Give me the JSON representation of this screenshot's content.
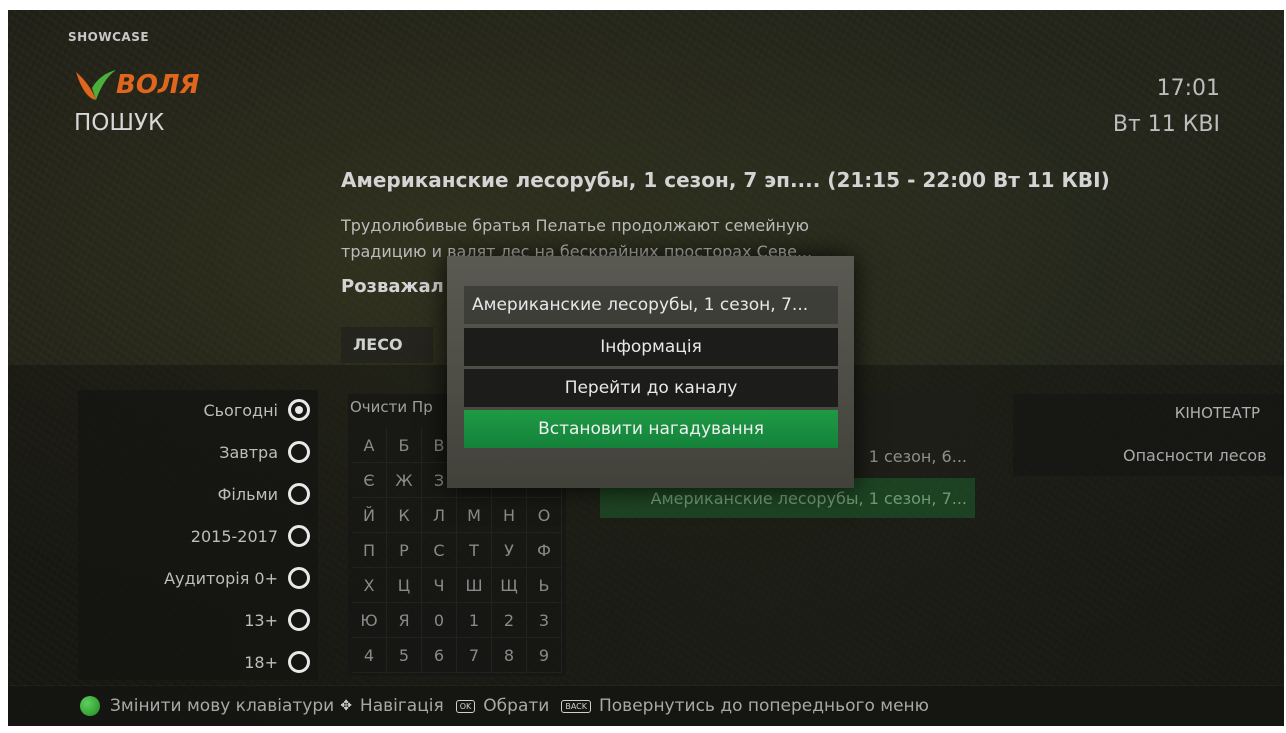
{
  "header": {
    "channel_label": "SHOWCASE",
    "brand": "ВОЛЯ",
    "page_title": "ПОШУК",
    "time": "17:01",
    "date": "Вт 11 КВІ"
  },
  "program": {
    "title": "Американские лесорубы, 1 сезон, 7 эп.... (21:15 - 22:00 Вт 11 КВІ)",
    "description_line1": "Трудолюбивые братья Пелатье продолжают семейную",
    "description_line2": "традицию и валят лес на бескрайних просторах Севе...",
    "genre": "Розважал"
  },
  "search": {
    "query": "ЛЕСО"
  },
  "filters": [
    {
      "label": "Сьогодні",
      "selected": true
    },
    {
      "label": "Завтра",
      "selected": false
    },
    {
      "label": "Фільми",
      "selected": false
    },
    {
      "label": "2015-2017",
      "selected": false
    },
    {
      "label": "Аудиторія 0+",
      "selected": false
    },
    {
      "label": "13+",
      "selected": false
    },
    {
      "label": "18+",
      "selected": false
    }
  ],
  "keyboard": {
    "clear_label": "Очисти Пр",
    "keys": [
      "А",
      "Б",
      "В",
      "",
      "",
      "",
      "Є",
      "Ж",
      "З",
      "",
      "",
      "",
      "Й",
      "К",
      "Л",
      "М",
      "Н",
      "О",
      "П",
      "Р",
      "С",
      "Т",
      "У",
      "Ф",
      "Х",
      "Ц",
      "Ч",
      "Ш",
      "Щ",
      "Ь",
      "Ю",
      "Я",
      "0",
      "1",
      "2",
      "3",
      "4",
      "5",
      "6",
      "7",
      "8",
      "9"
    ]
  },
  "results": {
    "items": [
      "1 сезон, 6...",
      "Американские лесорубы, 1 сезон, 7..."
    ]
  },
  "cinema": {
    "header": "КІНОТЕАТР",
    "item": "Опасности лесов"
  },
  "popup": {
    "title": "Американские лесорубы, 1 сезон, 7...",
    "items": [
      "Інформація",
      "Перейти до каналу",
      "Встановити нагадування"
    ]
  },
  "footer": {
    "change_lang": "Змінити мову клавіатури",
    "navigation": "Навігація",
    "ok_key": "OK",
    "select": "Обрати",
    "back_key": "BACK",
    "back": "Повернутись до попереднього меню"
  },
  "colors": {
    "accent_green": "#1f9a45",
    "brand_orange": "#e0661e"
  }
}
